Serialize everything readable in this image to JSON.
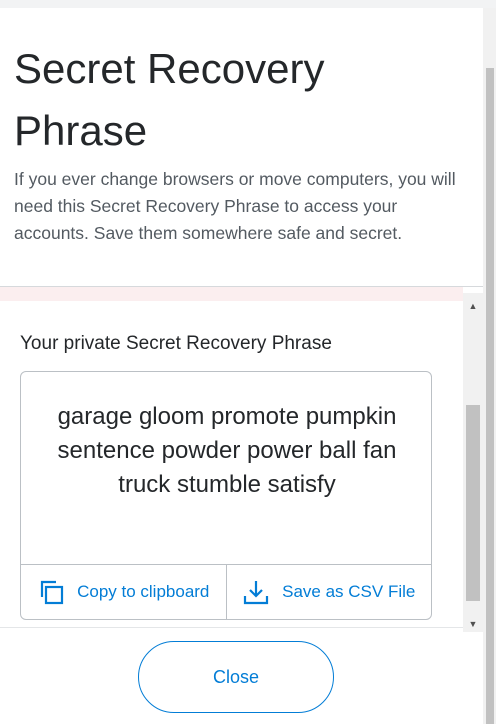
{
  "modal": {
    "title": "Secret Recovery Phrase",
    "description": "If you ever change browsers or move computers, you will need this Secret Recovery Phrase to access your accounts. Save them somewhere safe and secret."
  },
  "reveal": {
    "label": "Your private Secret Recovery Phrase",
    "phrase": "garage gloom promote pumpkin sentence powder power ball fan truck stumble satisfy",
    "copy_label": "Copy to clipboard",
    "save_label": "Save as CSV File"
  },
  "footer": {
    "close_label": "Close"
  },
  "icons": {
    "copy": "copy-icon",
    "save": "download-icon",
    "scroll_up": "chevron-up-icon",
    "scroll_down": "chevron-down-icon"
  },
  "colors": {
    "accent": "#037dd6",
    "text": "#24272a",
    "muted": "#535a61",
    "warning_tint": "#fbeeef"
  }
}
